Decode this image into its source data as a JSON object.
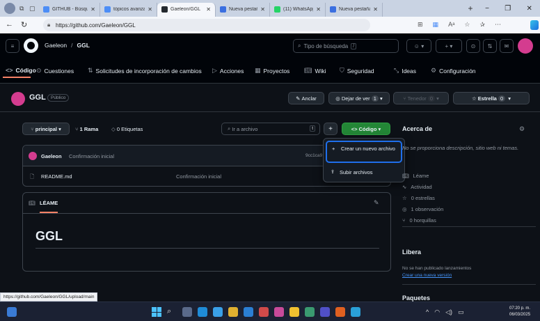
{
  "browser": {
    "tabs": [
      {
        "label": "GITHUB - Búsqu",
        "color": "#4c8df6"
      },
      {
        "label": "tópicos avanzado",
        "color": "#4c8df6"
      },
      {
        "label": "Gaeleon/GGL",
        "color": "#24292f"
      },
      {
        "label": "Nueva pestaña",
        "color": "#3b6fe0"
      },
      {
        "label": "(11) WhatsApp",
        "color": "#25d366"
      },
      {
        "label": "Nueva pestaña",
        "color": "#3b6fe0"
      }
    ],
    "url": "https://github.com/Gaeleon/GGL"
  },
  "header": {
    "owner": "Gaeleon",
    "separator": "/",
    "repo": "GGL",
    "search_placeholder": "Tipo de búsqueda",
    "search_shortcut": "/"
  },
  "repo_tabs": [
    "Código",
    "Cuestiones",
    "Solicitudes de incorporación de cambios",
    "Acciones",
    "Proyectos",
    "Wiki",
    "Seguridad",
    "Ideas",
    "Configuración"
  ],
  "repo_title": {
    "name": "GGL",
    "visibility": "Público",
    "pin": "Anclar",
    "watch": "Dejar de ver",
    "watch_count": "1",
    "fork": "Tenedor",
    "fork_count": "0",
    "star": "Estrella",
    "star_count": "0"
  },
  "toolbar": {
    "branch": "principal",
    "branches": "1 Rama",
    "tags": "0 Etiquetas",
    "goto_placeholder": "Ir a archivo",
    "goto_key": "t",
    "add": "+",
    "code": "Código"
  },
  "dropdown": {
    "create": "Crear un nuevo archivo",
    "upload": "Subir archivos"
  },
  "commit": {
    "author": "Gaeleon",
    "message": "Confirmación inicial",
    "hash_time": "9cc1ca9 · 33 minu"
  },
  "files": [
    {
      "name": "README.md",
      "message": "Confirmación inicial"
    }
  ],
  "readme": {
    "label": "LÉAME",
    "heading": "GGL"
  },
  "sidebar": {
    "about_title": "Acerca de",
    "about_text": "No se proporciona descripción, sitio web ni temas.",
    "items": [
      {
        "label": "Léame",
        "icon": "book-icon"
      },
      {
        "label": "Actividad",
        "icon": "pulse-icon"
      },
      {
        "label": "0 estrellas",
        "icon": "star-icon"
      },
      {
        "label": "1 observación",
        "icon": "eye-icon"
      },
      {
        "label": "0 horquillas",
        "icon": "fork-icon"
      }
    ],
    "releases_title": "Libera",
    "releases_text": "No se han publicado lanzamientos",
    "releases_link": "Crear una nueva versión",
    "packages_title": "Paquetes"
  },
  "status_url": "https://github.com/Gaeleon/GGL/upload/main",
  "taskbar": {
    "time": "07:20 p. m.",
    "date": "06/03/2025"
  },
  "colors": {
    "accent_green": "#238636",
    "link_blue": "#4493f8",
    "focus_blue": "#1f6feb"
  }
}
